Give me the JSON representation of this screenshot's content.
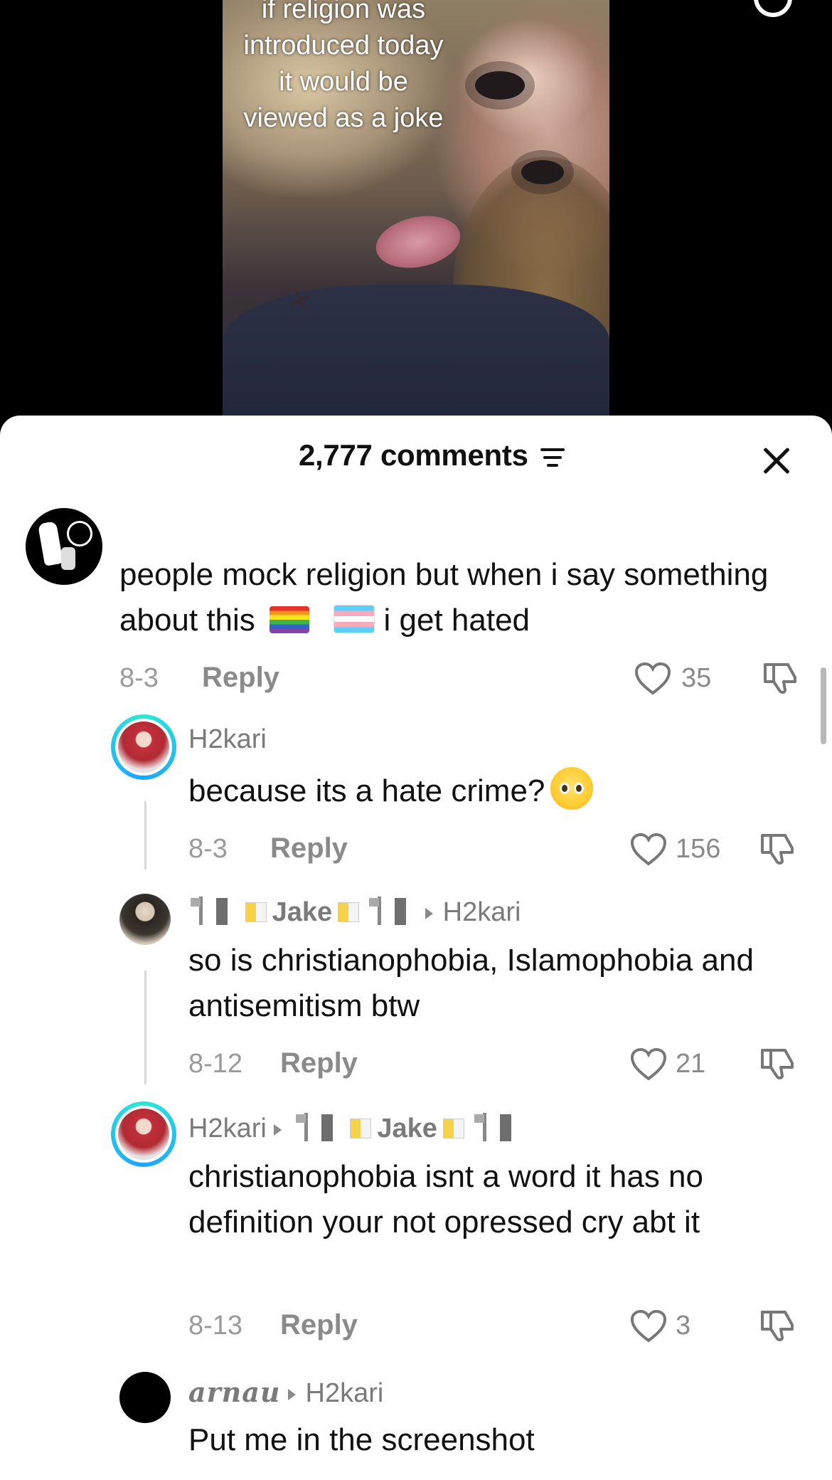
{
  "video": {
    "overlay_text": "if religion was introduced today it would be viewed as a joke"
  },
  "sheet": {
    "comment_count": "2,777 comments"
  },
  "comments": [
    {
      "text_part1": "people mock religion but when i say something about this",
      "text_part2": "i get hated",
      "date": "8-3",
      "reply_label": "Reply",
      "likes": "35"
    },
    {
      "username": "H2kari",
      "text": "because its a hate crime?",
      "date": "8-3",
      "reply_label": "Reply",
      "likes": "156"
    },
    {
      "username": "Jake",
      "reply_to": "H2kari",
      "text": "so is christianophobia, Islamophobia and antisemitism btw",
      "date": "8-12",
      "reply_label": "Reply",
      "likes": "21"
    },
    {
      "username": "H2kari",
      "reply_to": "Jake",
      "text": "christianophobia isnt a word it has no definition your not opressed cry abt it",
      "date": "8-13",
      "reply_label": "Reply",
      "likes": "3"
    },
    {
      "username": "arnau",
      "reply_to": "H2kari",
      "text": "Put me in the screenshot"
    }
  ],
  "icons": {
    "heart": "heart-outline-icon",
    "dislike": "thumbs-down-icon",
    "sort": "sort-icon",
    "close": "close-icon"
  }
}
